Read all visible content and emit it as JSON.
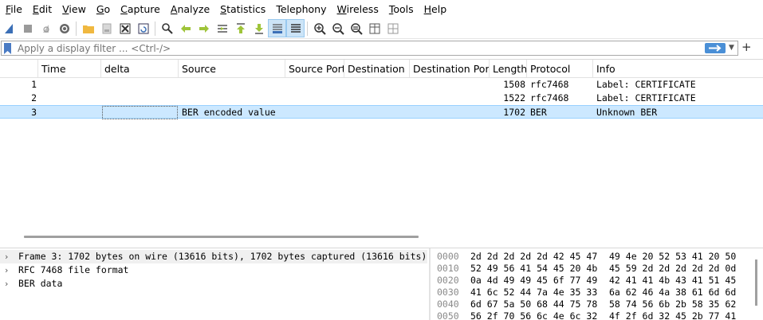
{
  "menu": [
    {
      "label": "File",
      "u": "F",
      "rest": "ile"
    },
    {
      "label": "Edit",
      "u": "E",
      "rest": "dit"
    },
    {
      "label": "View",
      "u": "V",
      "rest": "iew"
    },
    {
      "label": "Go",
      "u": "G",
      "rest": "o"
    },
    {
      "label": "Capture",
      "u": "C",
      "rest": "apture"
    },
    {
      "label": "Analyze",
      "u": "A",
      "rest": "nalyze"
    },
    {
      "label": "Statistics",
      "u": "S",
      "rest": "tatistics"
    },
    {
      "label": "Telephony",
      "u": "",
      "rest": "Telephony"
    },
    {
      "label": "Wireless",
      "u": "W",
      "rest": "ireless"
    },
    {
      "label": "Tools",
      "u": "T",
      "rest": "ools"
    },
    {
      "label": "Help",
      "u": "H",
      "rest": "elp"
    }
  ],
  "filter": {
    "placeholder": "Apply a display filter ... <Ctrl-/>"
  },
  "columns": [
    "Time",
    "delta",
    "Source",
    "Source Port",
    "Destination",
    "Destination Port",
    "Length",
    "Protocol",
    "Info"
  ],
  "packets": [
    {
      "no": "1",
      "time": "",
      "delta": "",
      "source": "",
      "srcport": "",
      "dest": "",
      "dstport": "",
      "length": "1508",
      "protocol": "rfc7468",
      "info": "Label: CERTIFICATE"
    },
    {
      "no": "2",
      "time": "",
      "delta": "",
      "source": "",
      "srcport": "",
      "dest": "",
      "dstport": "",
      "length": "1522",
      "protocol": "rfc7468",
      "info": "Label: CERTIFICATE"
    },
    {
      "no": "3",
      "time": "",
      "delta": "",
      "source": "BER encoded value",
      "srcport": "",
      "dest": "",
      "dstport": "",
      "length": "1702",
      "protocol": "BER",
      "info": "Unknown BER"
    }
  ],
  "details": [
    "Frame 3: 1702 bytes on wire (13616 bits), 1702 bytes captured (13616 bits)",
    "RFC 7468 file format",
    "BER data"
  ],
  "bytes": [
    {
      "offset": "0000",
      "hex1": "2d 2d 2d 2d 2d 42 45 47",
      "hex2": "49 4e 20 52 53 41 20 50"
    },
    {
      "offset": "0010",
      "hex1": "52 49 56 41 54 45 20 4b",
      "hex2": "45 59 2d 2d 2d 2d 2d 0d"
    },
    {
      "offset": "0020",
      "hex1": "0a 4d 49 49 45 6f 77 49",
      "hex2": "42 41 41 4b 43 41 51 45"
    },
    {
      "offset": "0030",
      "hex1": "41 6c 52 44 7a 4e 35 33",
      "hex2": "6a 62 46 4a 38 61 6d 6d"
    },
    {
      "offset": "0040",
      "hex1": "6d 67 5a 50 68 44 75 78",
      "hex2": "58 74 56 6b 2b 58 35 62"
    },
    {
      "offset": "0050",
      "hex1": "56 2f 70 56 6c 4e 6c 32",
      "hex2": "4f 2f 6d 32 45 2b 77 41"
    }
  ],
  "colors": {
    "selection": "#cce8ff",
    "accent": "#4a8fd6"
  },
  "icons": [
    "shark-fin-start-icon",
    "stop-icon",
    "restart-icon",
    "options-gear-icon",
    "open-folder-icon",
    "save-file-icon",
    "close-file-icon",
    "reload-icon",
    "find-icon",
    "back-arrow-icon",
    "forward-arrow-icon",
    "goto-packet-icon",
    "first-packet-icon",
    "last-packet-icon",
    "autoscroll-icon",
    "colorize-icon",
    "zoom-in-icon",
    "zoom-out-icon",
    "zoom-normal-icon",
    "resize-columns-icon",
    "layout-icon"
  ]
}
